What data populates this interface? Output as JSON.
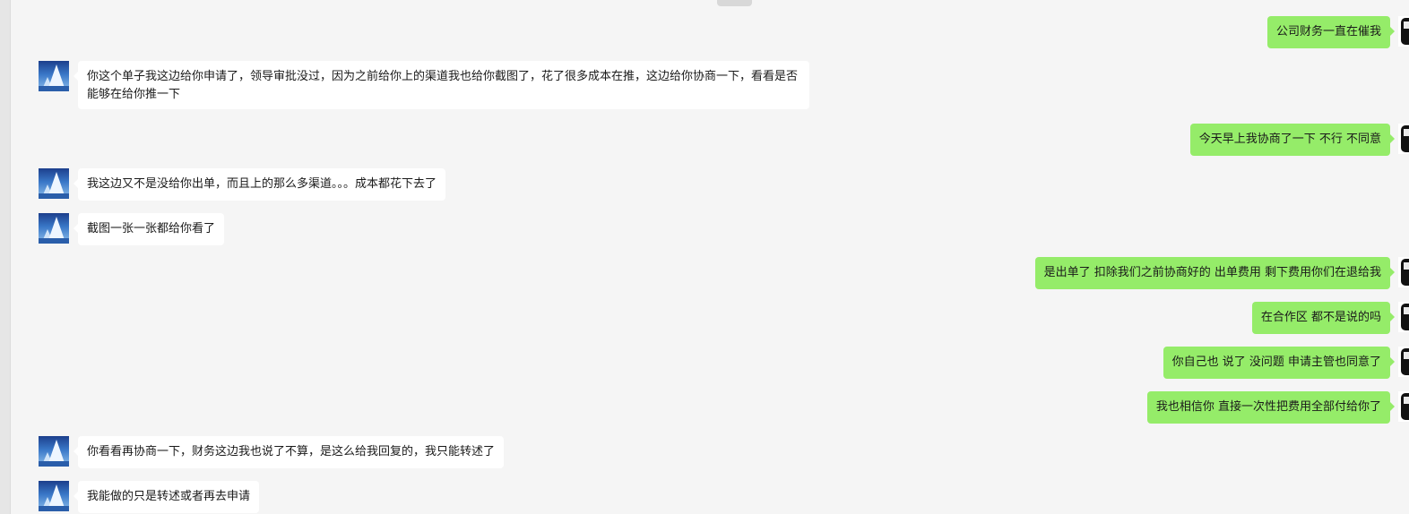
{
  "messages": [
    {
      "side": "right",
      "text": "公司财务一直在催我"
    },
    {
      "side": "left",
      "text": "你这个单子我这边给你申请了，领导审批没过，因为之前给你上的渠道我也给你截图了，花了很多成本在推，这边给你协商一下，看看是否能够在给你推一下"
    },
    {
      "side": "right",
      "text": "今天早上我协商了一下 不行 不同意"
    },
    {
      "side": "left",
      "text": "我这边又不是没给你出单，而且上的那么多渠道。。。成本都花下去了"
    },
    {
      "side": "left",
      "text": "截图一张一张都给你看了"
    },
    {
      "side": "right",
      "text": "是出单了  扣除我们之前协商好的 出单费用 剩下费用你们在退给我"
    },
    {
      "side": "right",
      "text": "在合作区  都不是说的吗"
    },
    {
      "side": "right",
      "text": "你自己也 说了 没问题  申请主管也同意了"
    },
    {
      "side": "right",
      "text": "我也相信你  直接一次性把费用全部付给你了"
    },
    {
      "side": "left",
      "text": "你看看再协商一下，财务这边我也说了不算，是这么给我回复的，我只能转述了"
    },
    {
      "side": "left",
      "text": "我能做的只是转述或者再去申请"
    }
  ],
  "colors": {
    "background": "#f5f5f5",
    "sent_bubble": "#95ec69",
    "received_bubble": "#ffffff"
  }
}
